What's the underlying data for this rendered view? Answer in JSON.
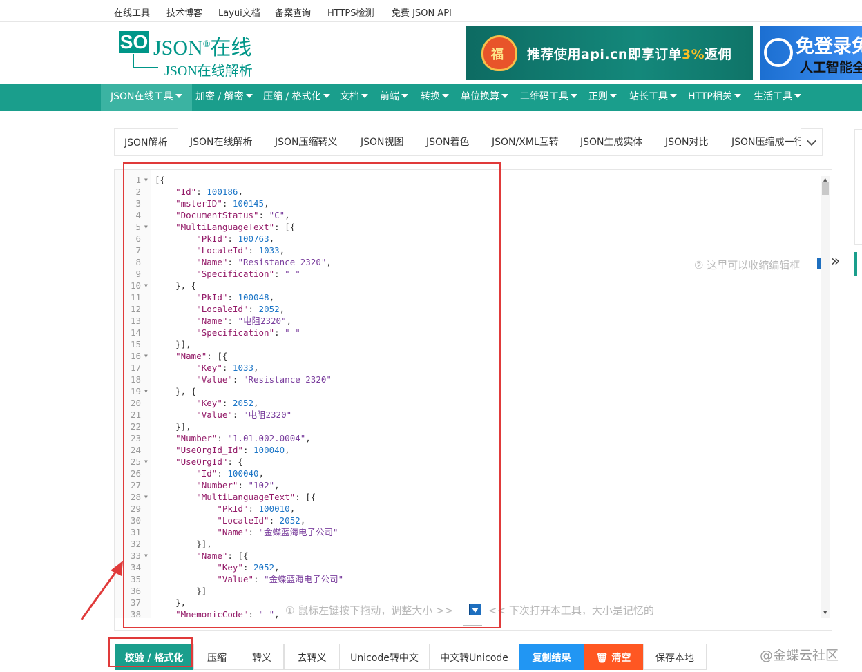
{
  "topbar": {
    "links": [
      "在线工具",
      "技术博客",
      "Layui文档",
      "备案查询",
      "HTTPS检测",
      "免费 JSON API"
    ]
  },
  "logo": {
    "box": "SO",
    "main": "JSON",
    "reg": "®",
    "cn": "在线",
    "sub": "JSON在线解析"
  },
  "ads": {
    "banner1": {
      "prefix": "推荐使用api.cn即享订单",
      "highlight": "3%",
      "suffix": "返佣",
      "bag_char": "福"
    },
    "banner2": {
      "line1": "免登录免",
      "line2": "人工智能全"
    }
  },
  "nav": {
    "items": [
      "JSON在线工具",
      "加密 / 解密",
      "压缩 / 格式化",
      "文档",
      "前端",
      "转换",
      "单位换算",
      "二维码工具",
      "正则",
      "站长工具",
      "HTTP相关",
      "生活工具"
    ]
  },
  "tabs": {
    "items": [
      "JSON解析",
      "JSON在线解析",
      "JSON压缩转义",
      "JSON视图",
      "JSON着色",
      "JSON/XML互转",
      "JSON生成实体",
      "JSON对比",
      "JSON压缩成一行"
    ]
  },
  "editor": {
    "lines": [
      "[{",
      "    \"Id\": 100186,",
      "    \"msterID\": 100145,",
      "    \"DocumentStatus\": \"C\",",
      "    \"MultiLanguageText\": [{",
      "        \"PkId\": 100763,",
      "        \"LocaleId\": 1033,",
      "        \"Name\": \"Resistance 2320\",",
      "        \"Specification\": \" \"",
      "    }, {",
      "        \"PkId\": 100048,",
      "        \"LocaleId\": 2052,",
      "        \"Name\": \"电阻2320\",",
      "        \"Specification\": \" \"",
      "    }],",
      "    \"Name\": [{",
      "        \"Key\": 1033,",
      "        \"Value\": \"Resistance 2320\"",
      "    }, {",
      "        \"Key\": 2052,",
      "        \"Value\": \"电阻2320\"",
      "    }],",
      "    \"Number\": \"1.01.002.0004\",",
      "    \"UseOrgId_Id\": 100040,",
      "    \"UseOrgId\": {",
      "        \"Id\": 100040,",
      "        \"Number\": \"102\",",
      "        \"MultiLanguageText\": [{",
      "            \"PkId\": 100010,",
      "            \"LocaleId\": 2052,",
      "            \"Name\": \"金蝶蓝海电子公司\"",
      "        }],",
      "        \"Name\": [{",
      "            \"Key\": 2052,",
      "            \"Value\": \"金蝶蓝海电子公司\"",
      "        }]",
      "    },",
      "    \"MnemonicCode\": \" \","
    ],
    "fold_lines": [
      1,
      5,
      10,
      16,
      19,
      25,
      28,
      33
    ],
    "hint_resize": "① 鼠标左键按下拖动，调整大小 >>",
    "hint_memory": "<< 下次打开本工具，大小是记忆的",
    "hint_collapse": "② 这里可以收缩编辑框"
  },
  "buttons": [
    "校验 / 格式化",
    "压缩",
    "转义",
    "去转义",
    "Unicode转中文",
    "中文转Unicode",
    "复制结果",
    "清空",
    "保存本地"
  ],
  "watermark": "@金蝶云社区"
}
